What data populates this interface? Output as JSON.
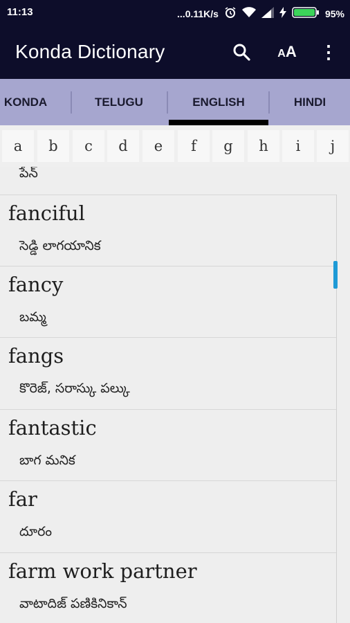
{
  "status_bar": {
    "time": "11:13",
    "network_speed": "...0.11K/s",
    "battery": "95%",
    "icons": [
      "alarm-icon",
      "wifi-icon",
      "signal-icon",
      "charging-icon",
      "battery-icon"
    ]
  },
  "app_bar": {
    "title": "Konda Dictionary",
    "actions": [
      "search-icon",
      "text-size-icon",
      "more-vert-icon"
    ],
    "text_size_glyph_small": "A",
    "text_size_glyph_large": "A",
    "more_glyph": "⋮"
  },
  "tabs": [
    {
      "label": "KONDA"
    },
    {
      "label": "TELUGU"
    },
    {
      "label": "ENGLISH",
      "selected": true
    },
    {
      "label": "HINDI"
    }
  ],
  "alphabet": [
    "a",
    "b",
    "c",
    "d",
    "e",
    "f",
    "g",
    "h",
    "i",
    "j"
  ],
  "list": {
    "partial_top_meaning": "పేన్",
    "entries": [
      {
        "word": "fanciful",
        "meaning": "సెడ్డి లాగయానిక"
      },
      {
        "word": "fancy",
        "meaning": "బమ్మ"
      },
      {
        "word": "fangs",
        "meaning": "కొరెజ్, సరాస్కు పల్కు"
      },
      {
        "word": "fantastic",
        "meaning": "బాగ మనిక"
      },
      {
        "word": "far",
        "meaning": "దూరం"
      },
      {
        "word": "farm work partner",
        "meaning": "వాటాదిజ్ పణికినికాన్"
      }
    ]
  },
  "colors": {
    "app_bar": "#0d0d2a",
    "tab_bar": "#a6a6cf",
    "tab_indicator": "#000000",
    "scroll_thumb": "#1e9ad6",
    "list_background": "#eeeeee"
  }
}
